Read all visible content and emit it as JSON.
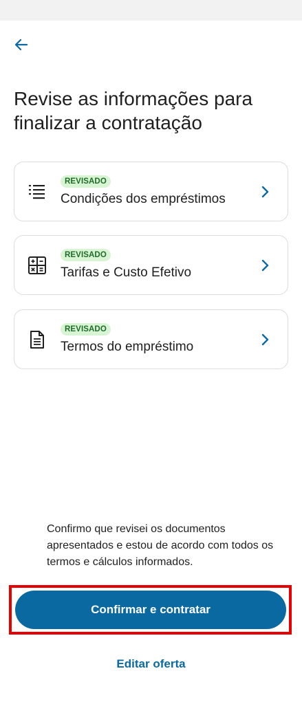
{
  "header": {
    "back_icon": "arrow-left-icon",
    "title": "Revise as informações para finalizar a contratação"
  },
  "colors": {
    "accent": "#0a69a0",
    "badge_bg": "#d8f5d3",
    "badge_text": "#1f6b2a",
    "highlight": "#e60000"
  },
  "cards": [
    {
      "icon": "list-icon",
      "badge": "REVISADO",
      "label": "Condições dos empréstimos"
    },
    {
      "icon": "calculator-icon",
      "badge": "REVISADO",
      "label": "Tarifas e Custo Efetivo"
    },
    {
      "icon": "document-icon",
      "badge": "REVISADO",
      "label": "Termos do empréstimo"
    }
  ],
  "footer": {
    "consent_text": "Confirmo que revisei os documentos apresentados e estou de acordo com todos os termos e cálculos informados.",
    "confirm_label": "Confirmar e contratar",
    "edit_label": "Editar oferta"
  }
}
